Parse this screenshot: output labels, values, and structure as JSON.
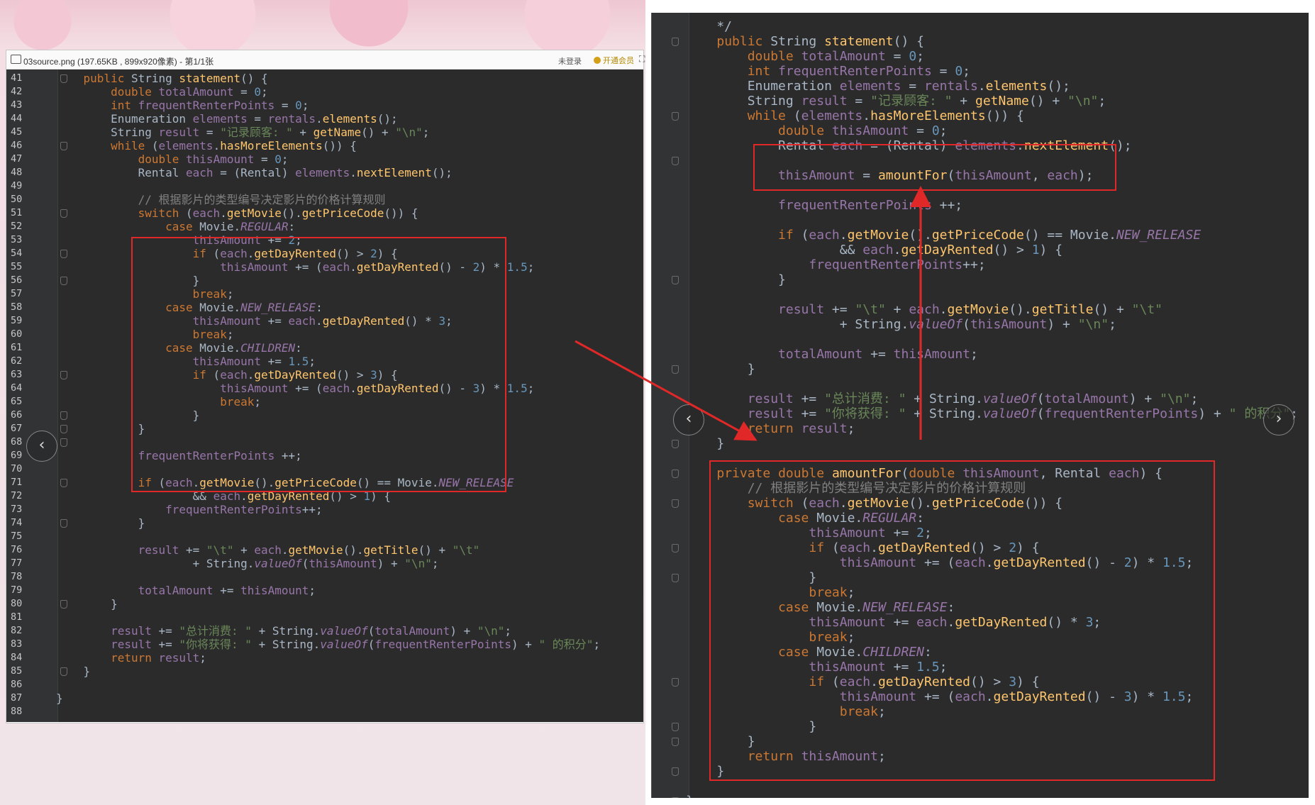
{
  "left_window": {
    "title": "03source.png (197.65KB , 899x920像素) - 第1/1张",
    "login": "未登录",
    "vip": "开通会员",
    "nav_prev": "‹",
    "line_numbers": [
      "41",
      "42",
      "43",
      "44",
      "45",
      "46",
      "47",
      "48",
      "49",
      "50",
      "51",
      "52",
      "53",
      "54",
      "55",
      "56",
      "57",
      "58",
      "59",
      "60",
      "61",
      "62",
      "63",
      "64",
      "65",
      "66",
      "67",
      "68",
      "69",
      "70",
      "71",
      "72",
      "73",
      "74",
      "75",
      "76",
      "77",
      "78",
      "79",
      "80",
      "81",
      "82",
      "83",
      "84",
      "85",
      "86",
      "87",
      "88"
    ],
    "code_lines": [
      "    public String statement() {",
      "        double totalAmount = 0;",
      "        int frequentRenterPoints = 0;",
      "        Enumeration elements = rentals.elements();",
      "        String result = \"记录顾客: \" + getName() + \"\\n\";",
      "        while (elements.hasMoreElements()) {",
      "            double thisAmount = 0;",
      "            Rental each = (Rental) elements.nextElement();",
      "",
      "            // 根据影片的类型编号决定影片的价格计算规则",
      "            switch (each.getMovie().getPriceCode()) {",
      "                case Movie.REGULAR:",
      "                    thisAmount += 2;",
      "                    if (each.getDayRented() > 2) {",
      "                        thisAmount += (each.getDayRented() - 2) * 1.5;",
      "                    }",
      "                    break;",
      "                case Movie.NEW_RELEASE:",
      "                    thisAmount += each.getDayRented() * 3;",
      "                    break;",
      "                case Movie.CHILDREN:",
      "                    thisAmount += 1.5;",
      "                    if (each.getDayRented() > 3) {",
      "                        thisAmount += (each.getDayRented() - 3) * 1.5;",
      "                        break;",
      "                    }",
      "            }",
      "",
      "            frequentRenterPoints ++;",
      "",
      "            if (each.getMovie().getPriceCode() == Movie.NEW_RELEASE",
      "                    && each.getDayRented() > 1) {",
      "                frequentRenterPoints++;",
      "            }",
      "",
      "            result += \"\\t\" + each.getMovie().getTitle() + \"\\t\"",
      "                    + String.valueOf(thisAmount) + \"\\n\";",
      "",
      "            totalAmount += thisAmount;",
      "        }",
      "",
      "        result += \"总计消费: \" + String.valueOf(totalAmount) + \"\\n\";",
      "        result += \"你将获得: \" + String.valueOf(frequentRenterPoints) + \" 的积分\";",
      "        return result;",
      "    }",
      "",
      "}",
      ""
    ]
  },
  "right_window": {
    "nav_prev": "‹",
    "nav_next": "›",
    "code_lines": [
      "    */",
      "    public String statement() {",
      "        double totalAmount = 0;",
      "        int frequentRenterPoints = 0;",
      "        Enumeration elements = rentals.elements();",
      "        String result = \"记录顾客: \" + getName() + \"\\n\";",
      "        while (elements.hasMoreElements()) {",
      "            double thisAmount = 0;",
      "            Rental each = (Rental) elements.nextElement();",
      "",
      "            thisAmount = amountFor(thisAmount, each);",
      "",
      "            frequentRenterPoints ++;",
      "",
      "            if (each.getMovie().getPriceCode() == Movie.NEW_RELEASE",
      "                    && each.getDayRented() > 1) {",
      "                frequentRenterPoints++;",
      "            }",
      "",
      "            result += \"\\t\" + each.getMovie().getTitle() + \"\\t\"",
      "                    + String.valueOf(thisAmount) + \"\\n\";",
      "",
      "            totalAmount += thisAmount;",
      "        }",
      "",
      "        result += \"总计消费: \" + String.valueOf(totalAmount) + \"\\n\";",
      "        result += \"你将获得: \" + String.valueOf(frequentRenterPoints) + \" 的积分\";",
      "        return result;",
      "    }",
      "",
      "    private double amountFor(double thisAmount, Rental each) {",
      "        // 根据影片的类型编号决定影片的价格计算规则",
      "        switch (each.getMovie().getPriceCode()) {",
      "            case Movie.REGULAR:",
      "                thisAmount += 2;",
      "                if (each.getDayRented() > 2) {",
      "                    thisAmount += (each.getDayRented() - 2) * 1.5;",
      "                }",
      "                break;",
      "            case Movie.NEW_RELEASE:",
      "                thisAmount += each.getDayRented() * 3;",
      "                break;",
      "            case Movie.CHILDREN:",
      "                thisAmount += 1.5;",
      "                if (each.getDayRented() > 3) {",
      "                    thisAmount += (each.getDayRented() - 3) * 1.5;",
      "                    break;",
      "                }",
      "        }",
      "        return thisAmount;",
      "    }",
      "",
      "}"
    ]
  },
  "colors": {
    "keyword": "#cc7832",
    "string": "#6a8759",
    "number": "#6897bb",
    "method": "#ffc66d",
    "field": "#9876aa",
    "comment": "#808080",
    "annotation_box": "#e02828"
  }
}
